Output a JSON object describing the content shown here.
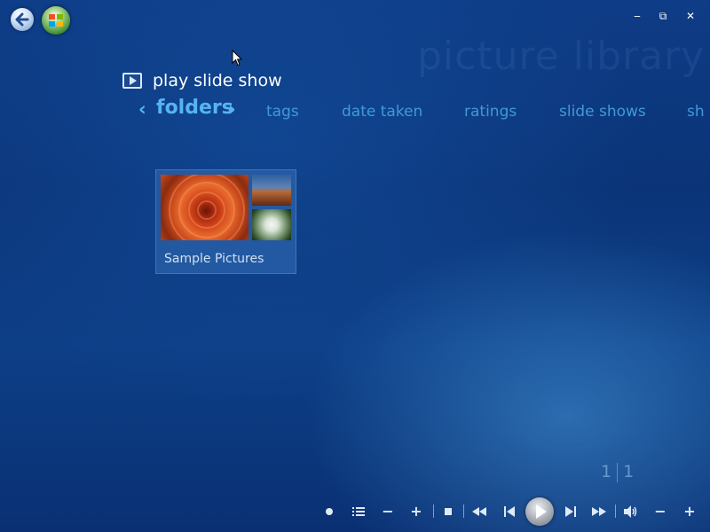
{
  "app": {
    "watermark_title": "picture library"
  },
  "toolbar": {
    "play_slide_show_label": "play slide show"
  },
  "pivot": {
    "active": "folders",
    "items": [
      "tags",
      "date taken",
      "ratings",
      "slide shows",
      "sh"
    ],
    "left_chevron": "‹",
    "right_chevron": "›"
  },
  "folders": [
    {
      "name": "Sample Pictures"
    }
  ],
  "pager": {
    "current": "1",
    "total": "1"
  },
  "window_controls": {
    "minimize": "‒",
    "restore": "⧉",
    "close": "✕"
  },
  "colors": {
    "background": "#0b3478",
    "accent": "#56b4f2",
    "pivot_inactive": "#3f9ad8"
  },
  "icons": {
    "back": "back-arrow-icon",
    "start": "windows-logo-icon",
    "play": "play-icon"
  }
}
